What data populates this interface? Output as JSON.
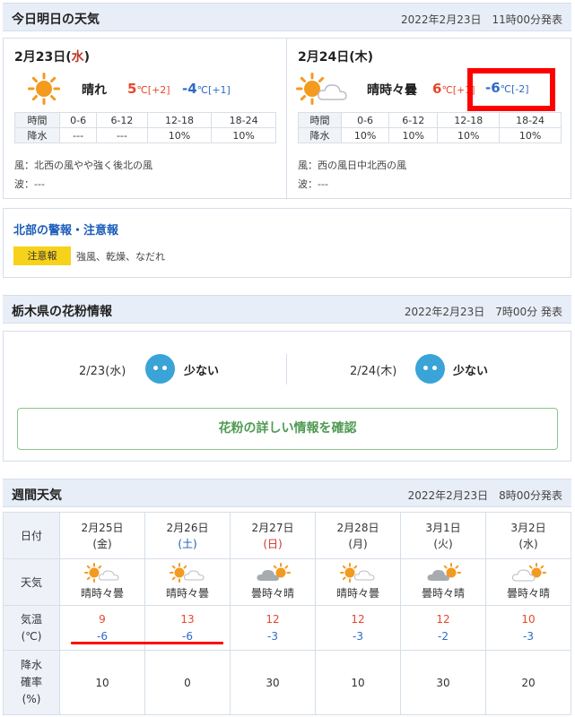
{
  "today_section": {
    "title": "今日明日の天気",
    "issued": "2022年2月23日　11時00分発表",
    "days": [
      {
        "date": "2月23日",
        "weekday": "水",
        "weather": "晴れ",
        "icon": "sun-icon",
        "max": "5",
        "max_diff": "[+2]",
        "min": "-4",
        "min_diff": "[+1]",
        "unit": "℃",
        "rain_header": [
          "時間",
          "0-6",
          "6-12",
          "12-18",
          "18-24"
        ],
        "rain_row": [
          "降水",
          "---",
          "---",
          "10%",
          "10%"
        ],
        "wind": "風：北西の風やや強く後北の風",
        "wave": "波：---"
      },
      {
        "date": "2月24日",
        "weekday": "木",
        "weather": "晴時々曇",
        "icon": "sun-cloud-icon",
        "max": "6",
        "max_diff": "[+1]",
        "min": "-6",
        "min_diff": "[-2]",
        "unit": "℃",
        "rain_header": [
          "時間",
          "0-6",
          "6-12",
          "12-18",
          "18-24"
        ],
        "rain_row": [
          "降水",
          "10%",
          "10%",
          "10%",
          "10%"
        ],
        "wind": "風：西の風日中北西の風",
        "wave": "波：---"
      }
    ]
  },
  "warning": {
    "title": "北部の警報・注意報",
    "badge": "注意報",
    "text": "強風、乾燥、なだれ"
  },
  "pollen": {
    "title": "栃木県の花粉情報",
    "issued": "2022年2月23日　7時00分 発表",
    "days": [
      {
        "date": "2/23(水)",
        "level": "少ない"
      },
      {
        "date": "2/24(木)",
        "level": "少ない"
      }
    ],
    "button": "花粉の詳しい情報を確認"
  },
  "weekly": {
    "title": "週間天気",
    "issued": "2022年2月23日　8時00分発表",
    "row_labels": {
      "date": "日付",
      "weather": "天気",
      "temp_line1": "気温",
      "temp_line2": "(℃)",
      "rain_line1": "降水",
      "rain_line2": "確率",
      "rain_line3": "(%)"
    },
    "days": [
      {
        "date": "2月25日",
        "dow": "(金)",
        "dow_color": "#333333",
        "weather": "晴時々曇",
        "icon": "sun-cloud-icon",
        "max": "9",
        "min": "-6",
        "rain": "10"
      },
      {
        "date": "2月26日",
        "dow": "(土)",
        "dow_color": "#1b5cb8",
        "weather": "晴時々曇",
        "icon": "sun-cloud-icon",
        "max": "13",
        "min": "-6",
        "rain": "0"
      },
      {
        "date": "2月27日",
        "dow": "(日)",
        "dow_color": "#d0312d",
        "weather": "曇時々晴",
        "icon": "cloud-sun-icon",
        "max": "12",
        "min": "-3",
        "rain": "30"
      },
      {
        "date": "2月28日",
        "dow": "(月)",
        "dow_color": "#333333",
        "weather": "晴時々曇",
        "icon": "sun-cloud-icon",
        "max": "12",
        "min": "-3",
        "rain": "10"
      },
      {
        "date": "3月1日",
        "dow": "(火)",
        "dow_color": "#333333",
        "weather": "曇時々晴",
        "icon": "cloud-sun-icon",
        "max": "12",
        "min": "-2",
        "rain": "30"
      },
      {
        "date": "3月2日",
        "dow": "(水)",
        "dow_color": "#333333",
        "weather": "曇時々晴",
        "icon": "cloud-sun-icon",
        "max": "10",
        "min": "-3",
        "rain": "20"
      }
    ]
  },
  "colors": {
    "header_bg": "#e8eef7",
    "max_temp": "#e8472d",
    "min_temp": "#2e6bc5",
    "annotation": "#ff0000",
    "warning_badge": "#f7d21a",
    "pollen_face": "#3aa3d7"
  }
}
